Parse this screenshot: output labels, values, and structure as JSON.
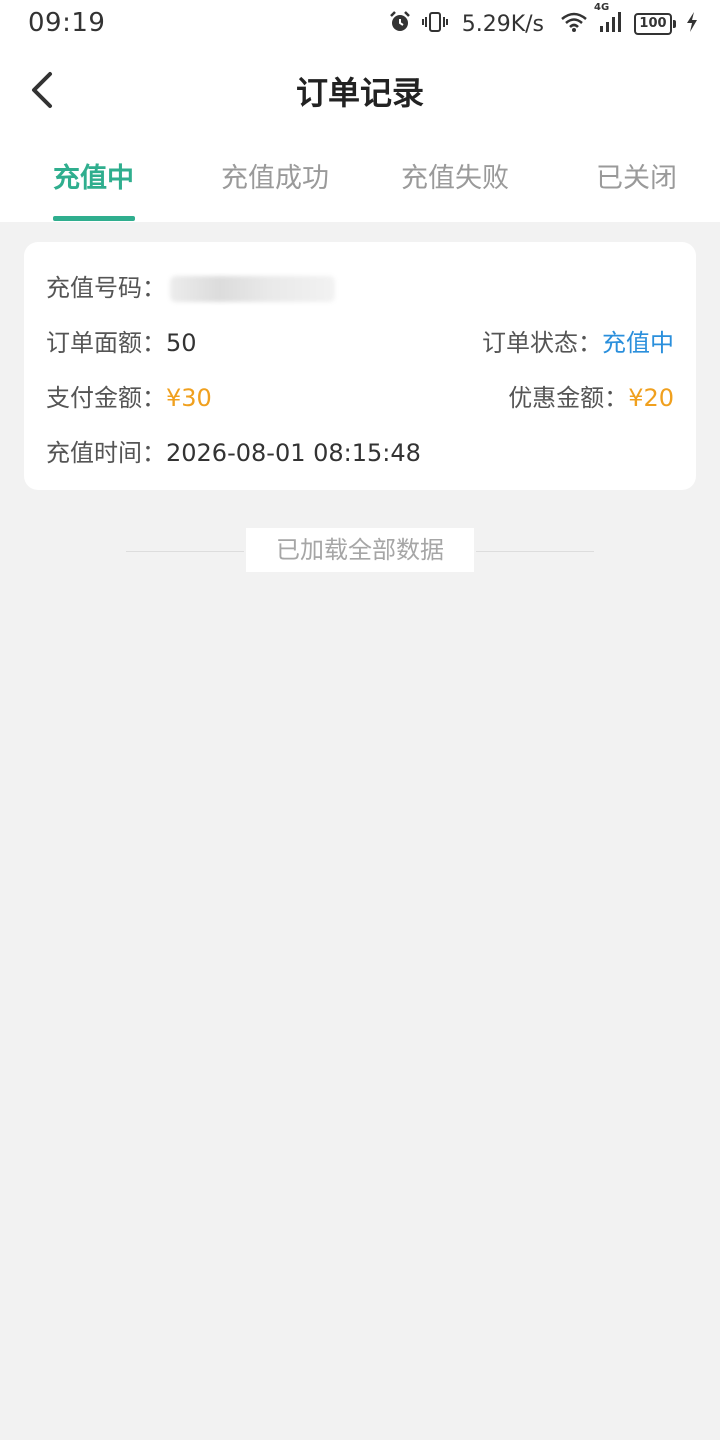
{
  "status_bar": {
    "time": "09:19",
    "net_speed": "5.29K/s",
    "signal_type": "4G",
    "battery": "100",
    "icons": [
      "alarm-icon",
      "vibrate-icon",
      "wifi-icon",
      "signal-icon",
      "battery-icon",
      "charging-icon"
    ]
  },
  "header": {
    "title": "订单记录",
    "back_icon": "chevron-left-icon"
  },
  "tabs": [
    {
      "label": "充值中",
      "active": true
    },
    {
      "label": "充值成功",
      "active": false
    },
    {
      "label": "充值失败",
      "active": false
    },
    {
      "label": "已关闭",
      "active": false
    }
  ],
  "order": {
    "phone_label": "充值号码：",
    "phone_value_masked": "",
    "face_label": "订单面额：",
    "face_value": "50",
    "status_label": "订单状态：",
    "status_value": "充值中",
    "pay_label": "支付金额：",
    "pay_value": "¥30",
    "discount_label": "优惠金额：",
    "discount_value": "¥20",
    "time_label": "充值时间：",
    "time_value": "2026-08-01 08:15:48"
  },
  "footer": {
    "loaded_all": "已加载全部数据"
  },
  "colors": {
    "accent": "#2fae8e",
    "status_blue": "#2a8fdc",
    "amount_orange": "#f0a01e",
    "page_bg": "#f2f2f2"
  }
}
